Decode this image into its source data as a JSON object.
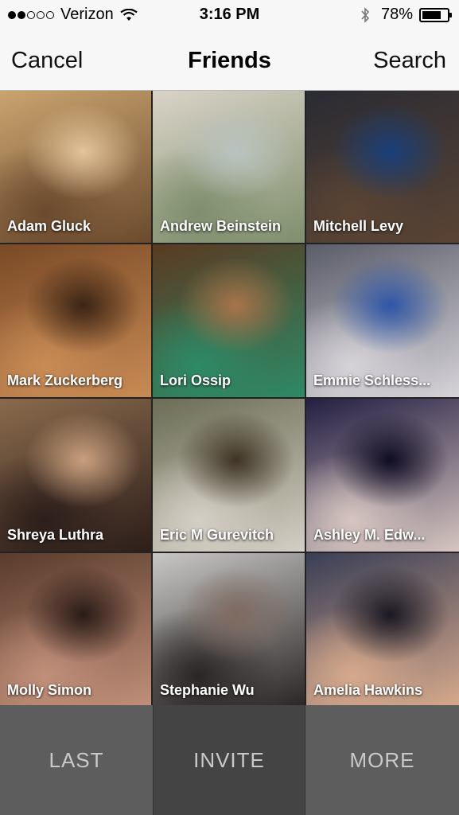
{
  "status_bar": {
    "carrier": "Verizon",
    "time": "3:16 PM",
    "battery": "78%",
    "battery_level": 0.78,
    "signal_bars_filled": 2,
    "signal_bars_total": 5
  },
  "nav": {
    "cancel": "Cancel",
    "title": "Friends",
    "search": "Search"
  },
  "friends": [
    {
      "name": "Adam Gluck",
      "colors": [
        "#c9a46f",
        "#6b4a2e",
        "#e2c39a"
      ]
    },
    {
      "name": "Andrew Beinstein",
      "colors": [
        "#d9d3c7",
        "#7f8e6d",
        "#b9c3bf"
      ]
    },
    {
      "name": "Mitchell Levy",
      "colors": [
        "#2a2b33",
        "#5a4434",
        "#1a3f7a"
      ]
    },
    {
      "name": "Mark Zuckerberg",
      "colors": [
        "#7a4a26",
        "#c88b55",
        "#3b2414"
      ]
    },
    {
      "name": "Lori Ossip",
      "colors": [
        "#5a3a22",
        "#2d8a66",
        "#a8744b"
      ]
    },
    {
      "name": "Emmie Schlessinger",
      "display": "Emmie Schless...",
      "colors": [
        "#5b5d6a",
        "#d6d3d8",
        "#2f56a8"
      ]
    },
    {
      "name": "Shreya Luthra",
      "colors": [
        "#8a6a4c",
        "#2c1e1a",
        "#c9a07e"
      ]
    },
    {
      "name": "Eric M Gurevitch",
      "colors": [
        "#6b6d55",
        "#d4cfc5",
        "#3f3324"
      ]
    },
    {
      "name": "Ashley M. Edwards",
      "display": "Ashley M. Edw...",
      "colors": [
        "#241f43",
        "#d6c5c0",
        "#0f0c22"
      ]
    },
    {
      "name": "Molly Simon",
      "colors": [
        "#5a3b2c",
        "#c08f7a",
        "#2a1c16"
      ]
    },
    {
      "name": "Stephanie Wu",
      "colors": [
        "#c8c7c5",
        "#2a2626",
        "#7f6a60"
      ]
    },
    {
      "name": "Amelia Hawkins",
      "colors": [
        "#3a3f56",
        "#d6a98c",
        "#1a1822"
      ]
    }
  ],
  "bottom_bar": {
    "last": "LAST",
    "invite": "INVITE",
    "more": "MORE"
  }
}
